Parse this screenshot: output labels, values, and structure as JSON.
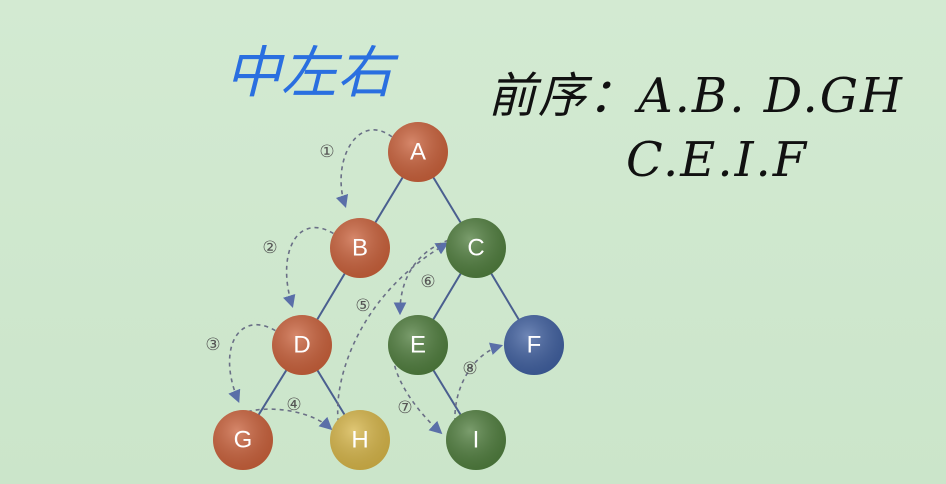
{
  "annotations": {
    "order_title": "中左右",
    "preorder_line1": "前序：A.B. D.GH",
    "preorder_line2": "C.E.I.F"
  },
  "tree": {
    "nodes": [
      {
        "id": "A",
        "label": "A",
        "color": "#c9603a"
      },
      {
        "id": "B",
        "label": "B",
        "color": "#c9603a"
      },
      {
        "id": "C",
        "label": "C",
        "color": "#4f7d3d"
      },
      {
        "id": "D",
        "label": "D",
        "color": "#c9603a"
      },
      {
        "id": "E",
        "label": "E",
        "color": "#4f7d3d"
      },
      {
        "id": "F",
        "label": "F",
        "color": "#3f5f9f"
      },
      {
        "id": "G",
        "label": "G",
        "color": "#c9603a"
      },
      {
        "id": "H",
        "label": "H",
        "color": "#d6b548"
      },
      {
        "id": "I",
        "label": "I",
        "color": "#4f7d3d"
      }
    ],
    "edges": [
      [
        "A",
        "B"
      ],
      [
        "A",
        "C"
      ],
      [
        "B",
        "D"
      ],
      [
        "C",
        "E"
      ],
      [
        "C",
        "F"
      ],
      [
        "D",
        "G"
      ],
      [
        "D",
        "H"
      ],
      [
        "E",
        "I"
      ]
    ],
    "steps": [
      {
        "label": "①",
        "from": "A",
        "to": "B"
      },
      {
        "label": "②",
        "from": "B",
        "to": "D"
      },
      {
        "label": "③",
        "from": "D",
        "to": "G"
      },
      {
        "label": "④",
        "from": "G",
        "to": "H"
      },
      {
        "label": "⑤",
        "from": "H",
        "to": "C"
      },
      {
        "label": "⑥",
        "from": "C",
        "to": "E"
      },
      {
        "label": "⑦",
        "from": "E",
        "to": "I"
      },
      {
        "label": "⑧",
        "from": "I",
        "to": "F"
      }
    ]
  }
}
